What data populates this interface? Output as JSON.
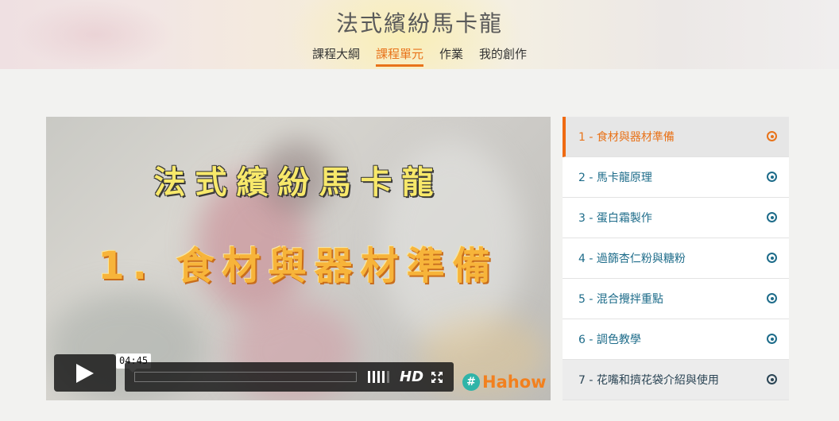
{
  "header": {
    "title": "法式繽紛馬卡龍",
    "nav": [
      {
        "label": "課程大綱",
        "active": false
      },
      {
        "label": "課程單元",
        "active": true
      },
      {
        "label": "作業",
        "active": false
      },
      {
        "label": "我的創作",
        "active": false
      }
    ]
  },
  "video": {
    "title_line1": "法式繽紛馬卡龍",
    "title_line2": "1. 食材與器材準備",
    "duration": "04:45",
    "hd_label": "HD",
    "logo_text": "Hahow",
    "icons": {
      "play": "play-icon",
      "volume": "volume-icon",
      "fullscreen": "fullscreen-icon",
      "logo": "hahow-logo-icon"
    }
  },
  "lessons": [
    {
      "label": "1 - 食材與器材準備",
      "active": true
    },
    {
      "label": "2 - 馬卡龍原理",
      "active": false
    },
    {
      "label": "3 - 蛋白霜製作",
      "active": false
    },
    {
      "label": "4 - 過篩杏仁粉與糖粉",
      "active": false
    },
    {
      "label": "5 - 混合攪拌重點",
      "active": false
    },
    {
      "label": "6 - 調色教學",
      "active": false
    },
    {
      "label": "7 - 花嘴和擠花袋介紹與使用",
      "active": false
    }
  ],
  "colors": {
    "accent": "#e8731a",
    "link": "#1e6c8a",
    "background": "#f2f2f0"
  }
}
